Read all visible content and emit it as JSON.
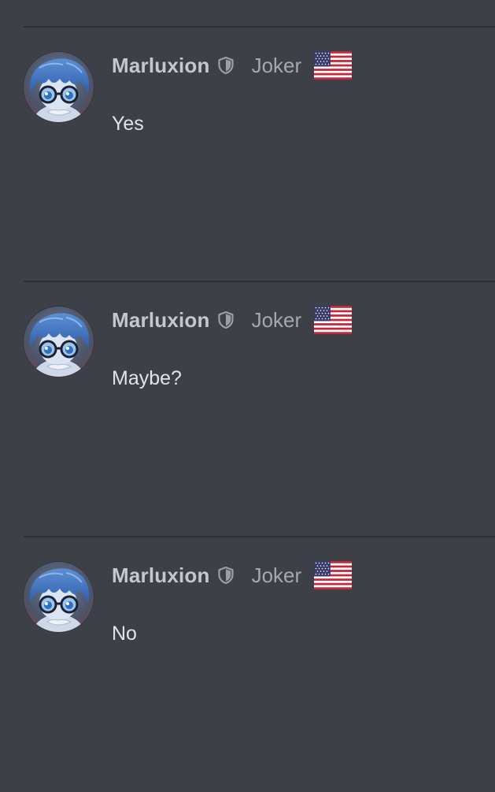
{
  "colors": {
    "background": "#3e4047",
    "divider": "#2d2f35",
    "username": "#c6c7cb",
    "role": "#a7a8ad",
    "message": "#e3e3e6"
  },
  "posts": [
    {
      "username": "Marluxion",
      "role": "Joker",
      "badge_icon": "shield-icon",
      "flag_icon": "us-flag-icon",
      "message": "Yes"
    },
    {
      "username": "Marluxion",
      "role": "Joker",
      "badge_icon": "shield-icon",
      "flag_icon": "us-flag-icon",
      "message": "Maybe?"
    },
    {
      "username": "Marluxion",
      "role": "Joker",
      "badge_icon": "shield-icon",
      "flag_icon": "us-flag-icon",
      "message": "No"
    }
  ]
}
